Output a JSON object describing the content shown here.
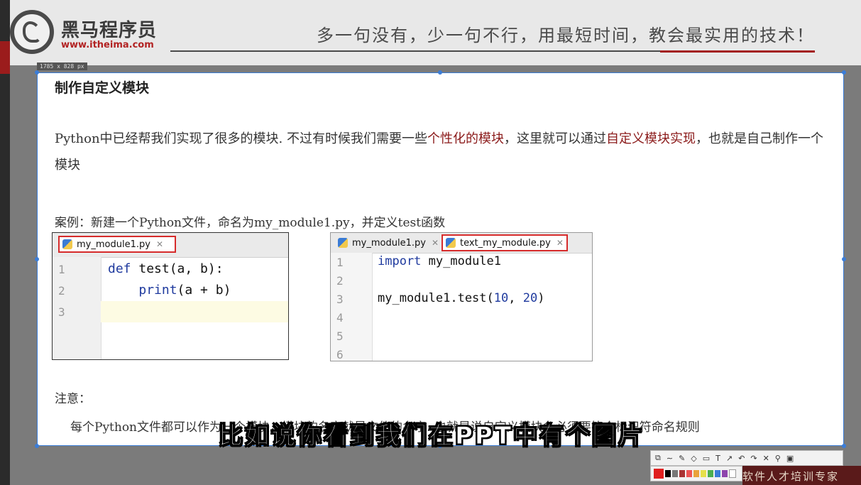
{
  "header": {
    "brand_name": "黑马程序员",
    "brand_url": "www.itheima.com",
    "slogan": "多一句没有，少一句不行，用最短时间，教会最实用的技术！"
  },
  "canvas_size_badge": "1785 x 828  px",
  "slide": {
    "title": "制作自定义模块",
    "para_part1": "Python中已经帮我们实现了很多的模块. 不过有时候我们需要一些",
    "para_hl1": "个性化的模块",
    "para_part2": "，这里就可以通过",
    "para_hl2": "自定义模块实现",
    "para_part3": "，也就是自己制作一个模块",
    "case_label": "案例",
    "case_text": "：新建一个Python文件，命名为my_module1.py，并定义test函数",
    "note_label": "注意：",
    "note_text": "每个Python文件都可以作为一个模块，模块的名字就是文件的名字. 也就是说自定义模块名必须要符合标识符命名规则"
  },
  "editor_left": {
    "tab": "my_module1.py",
    "lines": [
      {
        "num": "1",
        "code": "def test(a, b):"
      },
      {
        "num": "2",
        "code": "    print(a + b)"
      },
      {
        "num": "3",
        "code": ""
      }
    ]
  },
  "editor_right": {
    "tab1": "my_module1.py",
    "tab2": "text_my_module.py",
    "lines": [
      {
        "num": "1",
        "code": "import my_module1"
      },
      {
        "num": "2",
        "code": ""
      },
      {
        "num": "3",
        "code": "my_module1.test(10, 20)"
      },
      {
        "num": "4",
        "code": ""
      },
      {
        "num": "5",
        "code": ""
      },
      {
        "num": "6",
        "code": ""
      }
    ]
  },
  "subtitle": "比如说你看到我们在PPT中有个图片",
  "bottom_banner": "软件人才培训专家",
  "colors": {
    "accent_red": "#a31c1c",
    "highlight_red": "#8b1a1a",
    "selection_blue": "#3b7dd8",
    "keyword_blue": "#1f3a9e"
  },
  "icons": [
    "python-file-icon",
    "close-icon",
    "logo-horse-icon"
  ]
}
